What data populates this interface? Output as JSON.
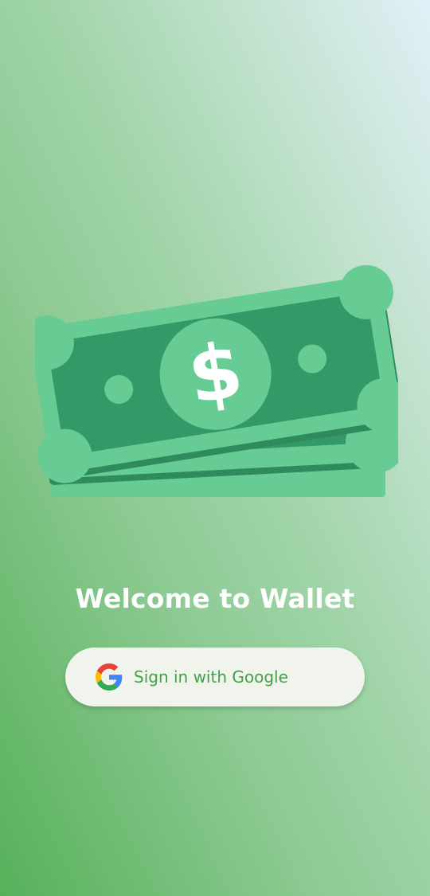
{
  "colors": {
    "bill_light": "#66cc94",
    "bill_dark": "#339966",
    "title_text": "#ffffff",
    "button_background": "#f1f4ec",
    "button_text": "#43a047"
  },
  "hero": {
    "icon": "money-bills-icon",
    "symbol": "$"
  },
  "welcome": {
    "title": "Welcome to Wallet"
  },
  "signin": {
    "icon": "google-icon",
    "label": "Sign in with Google"
  }
}
